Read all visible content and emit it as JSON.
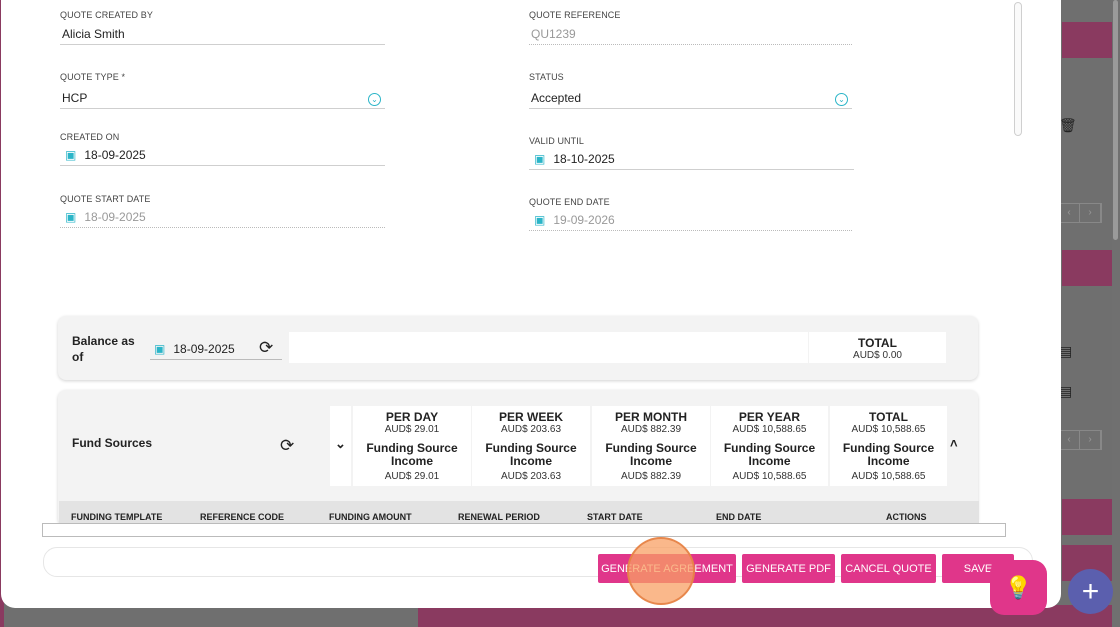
{
  "form": {
    "quote_created_by": {
      "label": "QUOTE CREATED BY",
      "value": "Alicia Smith"
    },
    "quote_reference": {
      "label": "QUOTE REFERENCE",
      "value": "QU1239"
    },
    "quote_type": {
      "label": "QUOTE TYPE *",
      "value": "HCP"
    },
    "status": {
      "label": "STATUS",
      "value": "Accepted"
    },
    "created_on": {
      "label": "CREATED ON",
      "value": "18-09-2025"
    },
    "valid_until": {
      "label": "VALID UNTIL",
      "value": "18-10-2025"
    },
    "quote_start_date": {
      "label": "QUOTE START DATE",
      "value": "18-09-2025"
    },
    "quote_end_date": {
      "label": "QUOTE END DATE",
      "value": "19-09-2026"
    }
  },
  "balance": {
    "label": "Balance as of",
    "date": "18-09-2025",
    "total_title": "TOTAL",
    "total_value": "AUD$ 0.00"
  },
  "fund_sources": {
    "label": "Fund Sources",
    "columns": [
      {
        "title": "PER DAY",
        "value": "AUD$ 29.01",
        "name": "Funding Source Income",
        "income": "AUD$ 29.01"
      },
      {
        "title": "PER WEEK",
        "value": "AUD$ 203.63",
        "name": "Funding Source Income",
        "income": "AUD$ 203.63"
      },
      {
        "title": "PER MONTH",
        "value": "AUD$ 882.39",
        "name": "Funding Source Income",
        "income": "AUD$ 882.39"
      },
      {
        "title": "PER YEAR",
        "value": "AUD$ 10,588.65",
        "name": "Funding Source Income",
        "income": "AUD$ 10,588.65"
      },
      {
        "title": "TOTAL",
        "value": "AUD$ 10,588.65",
        "name": "Funding Source Income",
        "income": "AUD$ 10,588.65"
      }
    ],
    "table_headers": [
      "FUNDING TEMPLATE",
      "REFERENCE CODE",
      "FUNDING AMOUNT",
      "RENEWAL PERIOD",
      "START DATE",
      "END DATE",
      "ACTIONS"
    ]
  },
  "buttons": {
    "generate_agreement": "GENERATE AGREEMENT",
    "generate_pdf": "GENERATE PDF",
    "cancel_quote": "CANCEL QUOTE",
    "save": "SAVE"
  },
  "colors": {
    "accent": "#e0368a",
    "icon": "#2bb5c8",
    "fab": "#5b5fae"
  }
}
